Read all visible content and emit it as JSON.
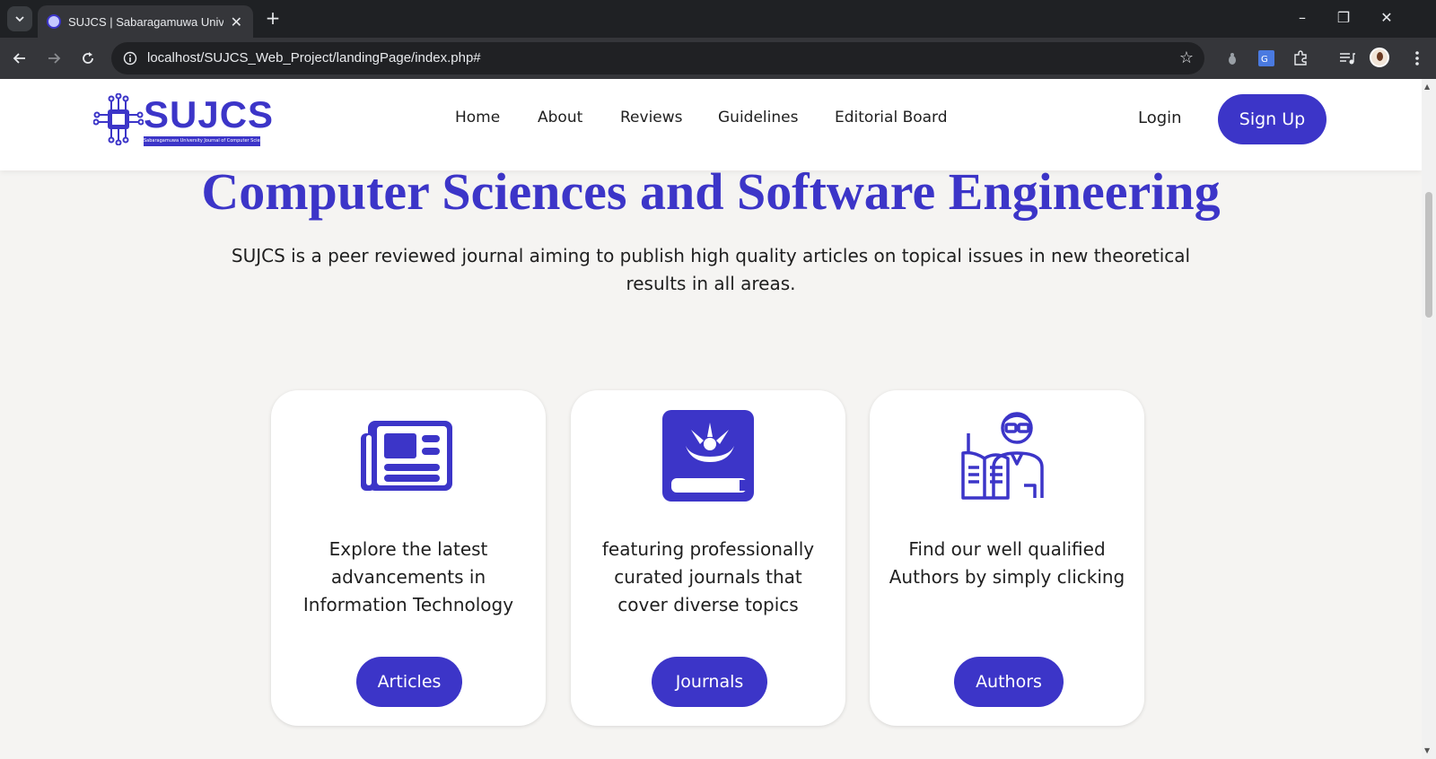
{
  "browser": {
    "tab_title": "SUJCS | Sabaragamuwa Univers",
    "url": "localhost/SUJCS_Web_Project/landingPage/index.php#"
  },
  "site": {
    "logo_text": "SUJCS",
    "logo_subtitle": "Sabaragamuwa University Journal of Computer Science",
    "nav": [
      "Home",
      "About",
      "Reviews",
      "Guidelines",
      "Editorial Board"
    ],
    "login_label": "Login",
    "signup_label": "Sign Up"
  },
  "hero": {
    "title": "Computer Sciences and Software Engineering",
    "description": "SUJCS is a peer reviewed journal aiming to publish high quality articles on topical issues in new theoretical results in all areas."
  },
  "cards": [
    {
      "icon": "newspaper-icon",
      "text": "Explore the latest advancements in Information Technology",
      "button": "Articles"
    },
    {
      "icon": "book-icon",
      "text": "featuring professionally curated journals that cover diverse topics",
      "button": "Journals"
    },
    {
      "icon": "author-reading-icon",
      "text": "Find our well qualified Authors by simply clicking",
      "button": "Authors"
    }
  ],
  "colors": {
    "accent": "#3c35c8",
    "page_bg": "#f5f4f2",
    "chrome_dark": "#1f2124"
  }
}
